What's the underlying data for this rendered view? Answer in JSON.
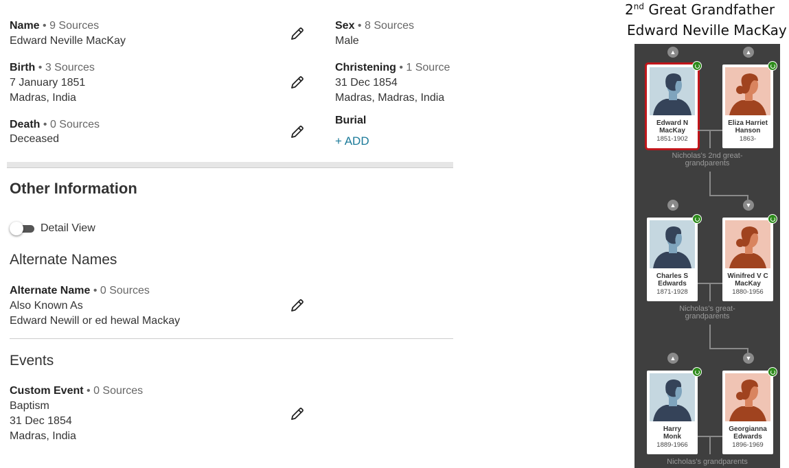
{
  "vitals": {
    "name": {
      "label": "Name",
      "sources": "9 Sources",
      "value": "Edward Neville MacKay"
    },
    "birth": {
      "label": "Birth",
      "sources": "3 Sources",
      "date": "7 January 1851",
      "place": "Madras, India"
    },
    "death": {
      "label": "Death",
      "sources": "0 Sources",
      "value": "Deceased"
    },
    "sex": {
      "label": "Sex",
      "sources": "8 Sources",
      "value": "Male"
    },
    "christening": {
      "label": "Christening",
      "sources": "1 Source",
      "date": "31 Dec 1854",
      "place": "Madras, Madras, India"
    },
    "burial": {
      "label": "Burial",
      "add": "+ ADD"
    }
  },
  "other_info": {
    "title": "Other Information",
    "detail_view": "Detail View"
  },
  "alternate_names": {
    "title": "Alternate Names",
    "label": "Alternate Name",
    "sources": "0 Sources",
    "type": "Also Known As",
    "value": "Edward Newill or ed hewal Mackay"
  },
  "events": {
    "title": "Events",
    "label": "Custom Event",
    "sources": "0 Sources",
    "type": "Baptism",
    "date": "31 Dec 1854",
    "place": "Madras, India"
  },
  "caption": {
    "ordinal": "2",
    "ordinal_suffix": "nd",
    "relation": " Great Grandfather",
    "name": "Edward Neville MacKay"
  },
  "tree": {
    "generations": [
      {
        "label": "Nicholas's 2nd great-grandparents",
        "label_lines": [
          "Nicholas's 2nd great-",
          "grandparents"
        ],
        "father": {
          "name_lines": [
            "Edward N",
            "MacKay"
          ],
          "dates": "1851-1902",
          "selected": true
        },
        "mother": {
          "name_lines": [
            "Eliza Harriet",
            "Hanson"
          ],
          "dates": "1863-"
        }
      },
      {
        "label": "Nicholas's great-grandparents",
        "label_lines": [
          "Nicholas's great-",
          "grandparents"
        ],
        "father": {
          "name_lines": [
            "Charles S",
            "Edwards"
          ],
          "dates": "1871-1928"
        },
        "mother": {
          "name_lines": [
            "Winifred V C",
            "MacKay"
          ],
          "dates": "1880-1956"
        }
      },
      {
        "label": "Nicholas's grandparents",
        "label_lines": [
          "Nicholas's grandparents"
        ],
        "father": {
          "name_lines": [
            "Harry",
            "Monk"
          ],
          "dates": "1889-1966"
        },
        "mother": {
          "name_lines": [
            "Georgianna",
            "Edwards"
          ],
          "dates": "1896-1969"
        }
      }
    ]
  },
  "colors": {
    "tree_background": "#3f3f3f",
    "male_portrait_bg": "#c5d7e0",
    "female_portrait_bg": "#f0c4b4",
    "selected_outline": "#c0151a",
    "hint_badge": "#2e8b1c",
    "link": "#1b7a99"
  }
}
